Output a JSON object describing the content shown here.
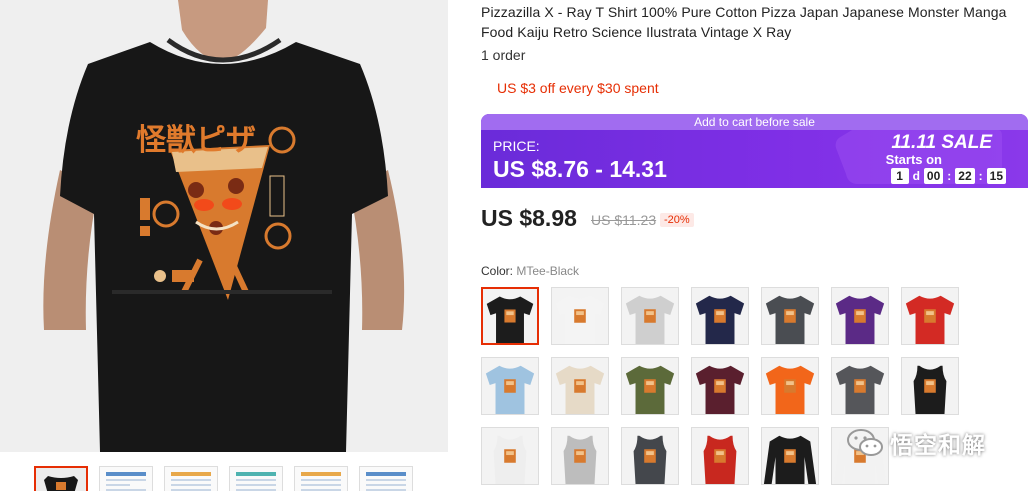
{
  "product": {
    "title": "Pizzazilla X - Ray T Shirt 100% Pure Cotton Pizza Japan Japanese Monster Manga Food Kaiju Retro Science Ilustrata Vintage X Ray",
    "orders": "1 order",
    "coupon": "US $3 off every $30 spent"
  },
  "banner": {
    "top_text": "Add to cart before sale",
    "price_label": "PRICE:",
    "price_range": "US $8.76 - 14.31",
    "sale_name": "11.11 SALE",
    "starts_label": "Starts on",
    "countdown": {
      "days": "1",
      "days_unit": "d",
      "hours": "00",
      "minutes": "22",
      "seconds": "15",
      "sep": ":"
    }
  },
  "price": {
    "current": "US $8.98",
    "original": "US $11.23",
    "discount": "-20%"
  },
  "color": {
    "label": "Color:",
    "value": "MTee-Black",
    "swatches": [
      {
        "name": "black-tee",
        "type": "tee",
        "color": "#1c1c1c"
      },
      {
        "name": "white-tee",
        "type": "tee",
        "color": "#f4f4f4"
      },
      {
        "name": "light-grey-tee",
        "type": "tee",
        "color": "#cfcfcf"
      },
      {
        "name": "navy-tee",
        "type": "tee",
        "color": "#23284a"
      },
      {
        "name": "charcoal-tee",
        "type": "tee",
        "color": "#4a4d52"
      },
      {
        "name": "purple-tee",
        "type": "tee",
        "color": "#5b2a86"
      },
      {
        "name": "red-tee",
        "type": "tee",
        "color": "#d32a24"
      },
      {
        "name": "light-blue-tee",
        "type": "tee",
        "color": "#9fc3e0"
      },
      {
        "name": "cream-tee",
        "type": "tee",
        "color": "#e6dac7"
      },
      {
        "name": "army-green-tee",
        "type": "tee",
        "color": "#5c6a3a"
      },
      {
        "name": "maroon-tee",
        "type": "tee",
        "color": "#5a1f2e"
      },
      {
        "name": "orange-tee",
        "type": "tee",
        "color": "#f2661a"
      },
      {
        "name": "dark-grey-tee",
        "type": "tee",
        "color": "#55565a"
      },
      {
        "name": "black-tank",
        "type": "tank",
        "color": "#1c1c1c"
      },
      {
        "name": "white-tank",
        "type": "tank",
        "color": "#eeeeee"
      },
      {
        "name": "heather-tank",
        "type": "tank",
        "color": "#bdbdbd"
      },
      {
        "name": "charcoal-tank",
        "type": "tank",
        "color": "#44474c"
      },
      {
        "name": "red-tank",
        "type": "tank",
        "color": "#c8281f"
      },
      {
        "name": "black-longsleeve",
        "type": "long",
        "color": "#1c1c1c"
      },
      {
        "name": "white-longsleeve",
        "type": "long",
        "color": "#f2f2f2"
      }
    ]
  },
  "gallery": {
    "thumbnails": [
      "product-photo",
      "size-chart-1",
      "size-chart-2",
      "size-chart-3",
      "size-chart-4",
      "size-chart-5"
    ],
    "print_text": "怪獣ピザ"
  },
  "watermark": {
    "text": "悟空和解"
  },
  "colors": {
    "accent": "#e62e04",
    "sale_purple": "#7f2fe6",
    "print_orange": "#e07a2c"
  }
}
